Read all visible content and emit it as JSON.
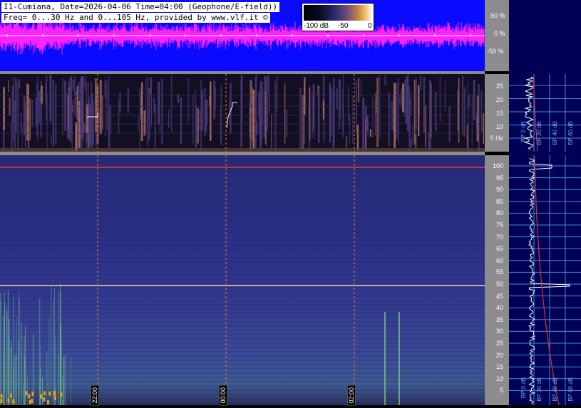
{
  "header": {
    "title_line": "I1-Cumiana, Date=2026-04-06 Time=04:00 (Geophone/E-field))",
    "freq_line": "Freq= 0...30 Hz and 0...105 Hz, provided by www.vlf.it ©"
  },
  "colorbar": {
    "labels": [
      "-100 dB",
      "-50",
      "0"
    ]
  },
  "amplitude_axis": {
    "labels": [
      "50 %",
      "0 %",
      "-50 %"
    ]
  },
  "low_band_axis": {
    "labels": [
      "25",
      "20",
      "15",
      "10",
      "5 Hz"
    ]
  },
  "high_band_axis": {
    "labels": [
      "100",
      "95",
      "90",
      "85",
      "80",
      "75",
      "70",
      "65",
      "60",
      "55",
      "50",
      "45",
      "40",
      "35",
      "30",
      "25",
      "20",
      "15",
      "10",
      "5"
    ]
  },
  "time_markers": {
    "labels": [
      "22:00",
      "00:00",
      "02:00"
    ]
  },
  "right_panel": {
    "bp_labels": [
      "BP 0 dB",
      "BP 20 dB",
      "BP 40 dB",
      "BP 60 dB"
    ]
  },
  "colors": {
    "waveform": "#ff22ff",
    "background_blue": "#0a0aff",
    "axis_grey": "#8c8c8c",
    "marker_orange": "#e08040",
    "hum_line": "#ff3030",
    "spectrum_line": "#ffffff",
    "curve_red": "#e03030",
    "grid_blue": "#3a8fd8"
  }
}
